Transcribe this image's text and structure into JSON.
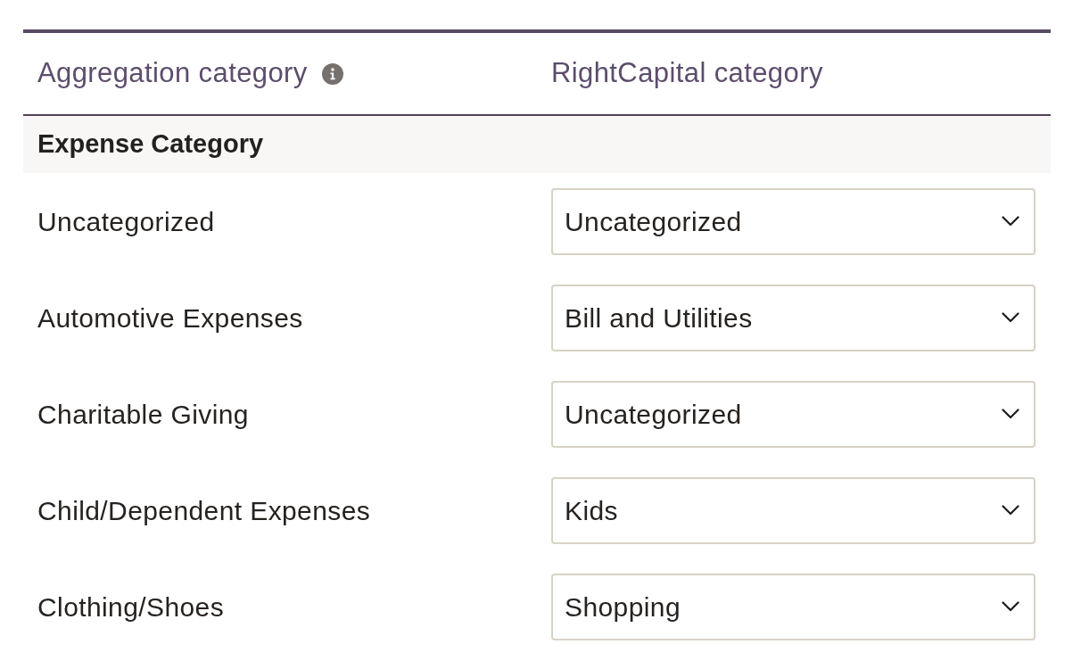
{
  "table": {
    "columns": [
      {
        "label": "Aggregation category",
        "info": true
      },
      {
        "label": "RightCapital category",
        "info": false
      }
    ],
    "groups": [
      {
        "title": "Expense Category",
        "rows": [
          {
            "aggregation": "Uncategorized",
            "category": "Uncategorized"
          },
          {
            "aggregation": "Automotive Expenses",
            "category": "Bill and Utilities"
          },
          {
            "aggregation": "Charitable Giving",
            "category": "Uncategorized"
          },
          {
            "aggregation": "Child/Dependent Expenses",
            "category": "Kids"
          },
          {
            "aggregation": "Clothing/Shoes",
            "category": "Shopping"
          }
        ]
      }
    ]
  }
}
